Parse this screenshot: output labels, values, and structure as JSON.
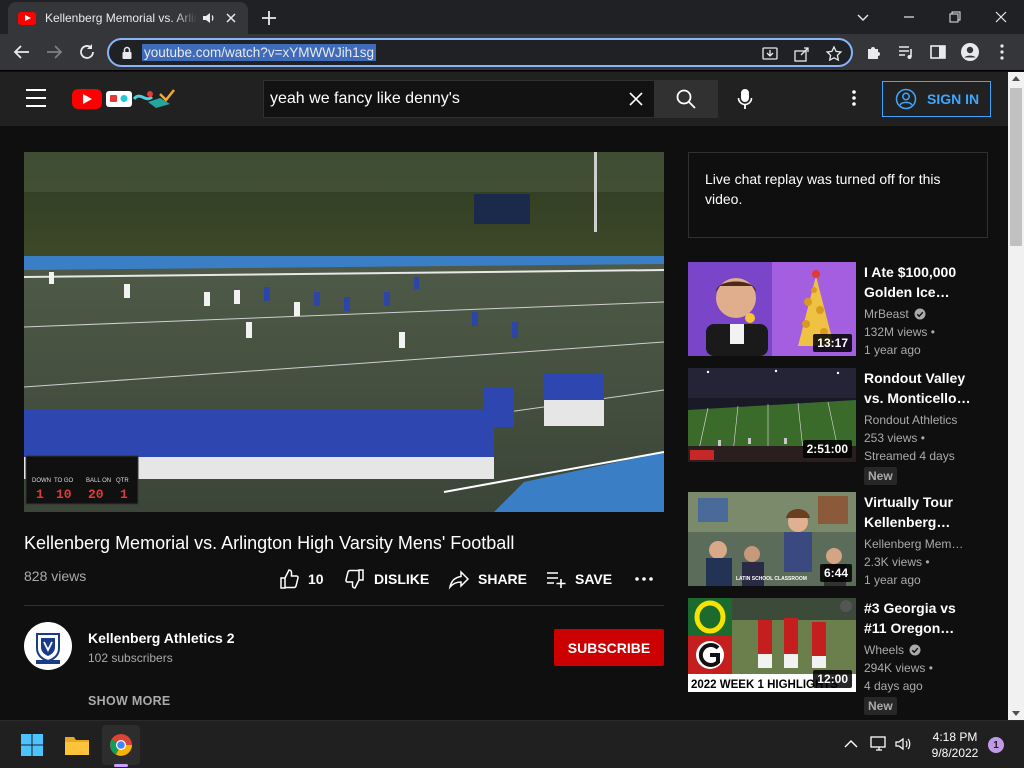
{
  "browser": {
    "tab_title": "Kellenberg Memorial vs. Arlington High Varsity Mens' Football",
    "url": "youtube.com/watch?v=xYMWWJih1sg"
  },
  "masthead": {
    "search_query": "yeah we fancy like denny's",
    "sign_in_label": "SIGN IN"
  },
  "video": {
    "title": "Kellenberg Memorial vs. Arlington High Varsity Mens' Football",
    "views": "828 views",
    "like_count": "10",
    "dislike_label": "DISLIKE",
    "share_label": "SHARE",
    "save_label": "SAVE"
  },
  "scoreboard": {
    "labels": [
      "DOWN",
      "TO GO",
      "BALL ON",
      "QTR"
    ],
    "values": [
      "1",
      "10",
      "20",
      "1"
    ]
  },
  "channel": {
    "name": "Kellenberg Athletics 2",
    "subscribers": "102 subscribers",
    "subscribe_label": "SUBSCRIBE",
    "show_more_label": "SHOW MORE"
  },
  "chat": {
    "message": "Live chat replay was turned off for this video."
  },
  "recommendations": [
    {
      "title_line1": "I Ate $100,000",
      "title_line2": "Golden Ice…",
      "channel": "MrBeast",
      "verified": true,
      "views": "132M views •",
      "age": "1 year ago",
      "duration": "13:17",
      "badge": ""
    },
    {
      "title_line1": "Rondout Valley",
      "title_line2": "vs. Monticello…",
      "channel": "Rondout Athletics",
      "verified": false,
      "views": "253 views •",
      "age": "Streamed 4 days",
      "duration": "2:51:00",
      "badge": "New"
    },
    {
      "title_line1": "Virtually Tour",
      "title_line2": "Kellenberg…",
      "channel": "Kellenberg Mem…",
      "verified": false,
      "views": "2.3K views •",
      "age": "1 year ago",
      "duration": "6:44",
      "thumb_caption": "LATIN SCHOOL CLASSROOM",
      "badge": ""
    },
    {
      "title_line1": "#3 Georgia vs",
      "title_line2": "#11 Oregon…",
      "channel": "Wheels",
      "verified": true,
      "views": "294K views •",
      "age": "4 days ago",
      "duration": "12:00",
      "thumb_caption": "2022 WEEK 1 HIGHLIGHTS",
      "badge": "New"
    }
  ],
  "taskbar": {
    "time": "4:18 PM",
    "date": "9/8/2022",
    "notification_count": "1"
  },
  "colors": {
    "youtube_red": "#ff0000",
    "subscribe_red": "#cc0000",
    "link_blue": "#3ea6ff",
    "page_bg": "#0f0f0f"
  }
}
